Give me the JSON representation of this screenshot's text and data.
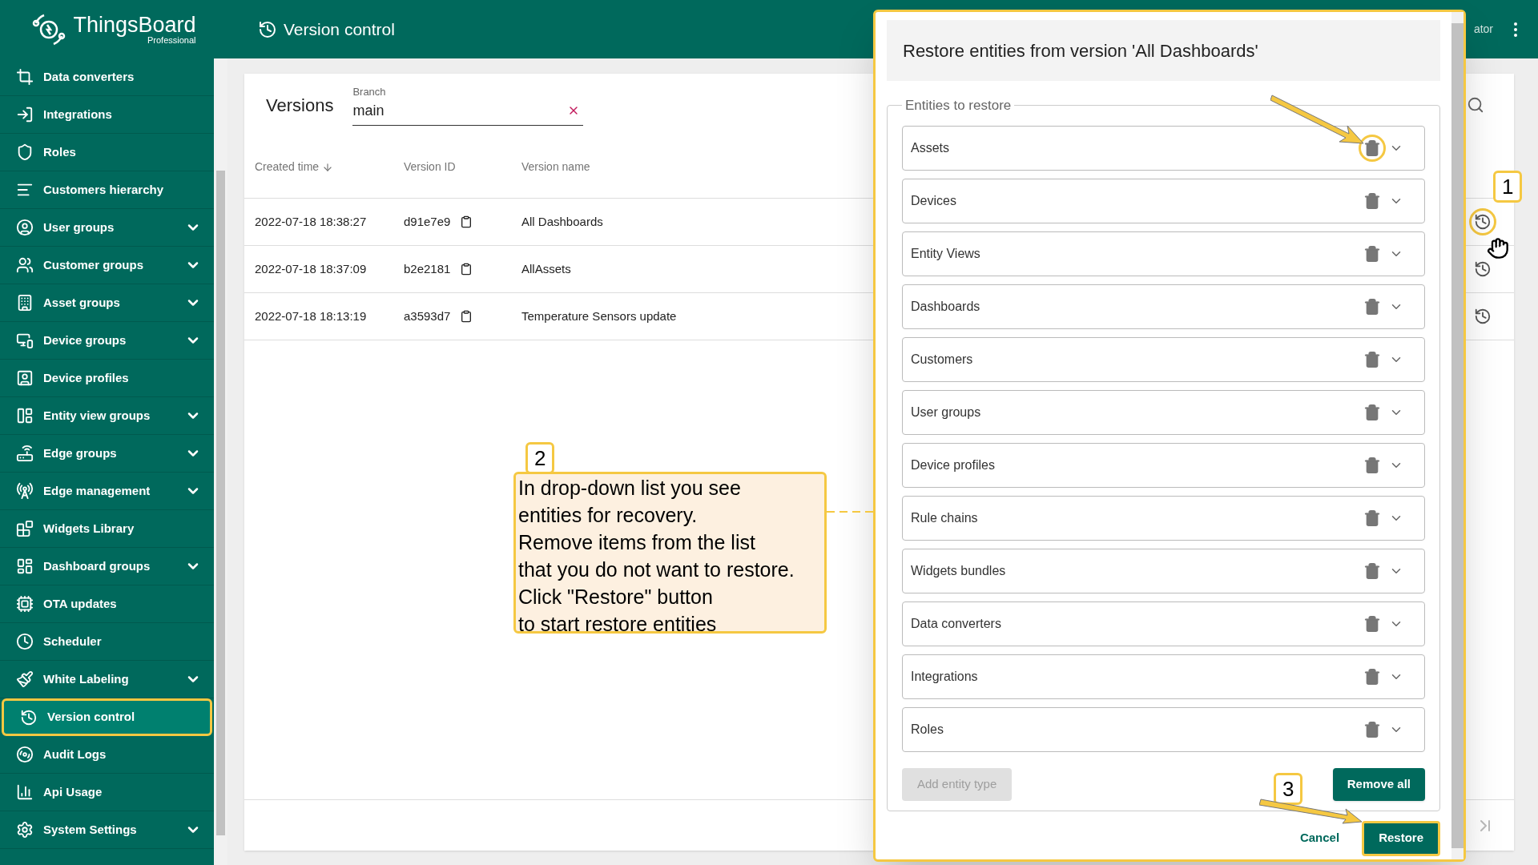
{
  "brand": {
    "name": "ThingsBoard",
    "edition": "Professional"
  },
  "header": {
    "title": "Version control",
    "user_text": "ator"
  },
  "sidebar": {
    "items": [
      {
        "label": "Data converters",
        "expandable": false,
        "selected": false
      },
      {
        "label": "Integrations",
        "expandable": false,
        "selected": false
      },
      {
        "label": "Roles",
        "expandable": false,
        "selected": false
      },
      {
        "label": "Customers hierarchy",
        "expandable": false,
        "selected": false
      },
      {
        "label": "User groups",
        "expandable": true,
        "selected": false
      },
      {
        "label": "Customer groups",
        "expandable": true,
        "selected": false
      },
      {
        "label": "Asset groups",
        "expandable": true,
        "selected": false
      },
      {
        "label": "Device groups",
        "expandable": true,
        "selected": false
      },
      {
        "label": "Device profiles",
        "expandable": false,
        "selected": false
      },
      {
        "label": "Entity view groups",
        "expandable": true,
        "selected": false
      },
      {
        "label": "Edge groups",
        "expandable": true,
        "selected": false
      },
      {
        "label": "Edge management",
        "expandable": true,
        "selected": false
      },
      {
        "label": "Widgets Library",
        "expandable": false,
        "selected": false
      },
      {
        "label": "Dashboard groups",
        "expandable": true,
        "selected": false
      },
      {
        "label": "OTA updates",
        "expandable": false,
        "selected": false
      },
      {
        "label": "Scheduler",
        "expandable": false,
        "selected": false
      },
      {
        "label": "White Labeling",
        "expandable": true,
        "selected": false
      },
      {
        "label": "Version control",
        "expandable": false,
        "selected": true
      },
      {
        "label": "Audit Logs",
        "expandable": false,
        "selected": false
      },
      {
        "label": "Api Usage",
        "expandable": false,
        "selected": false
      },
      {
        "label": "System Settings",
        "expandable": true,
        "selected": false
      }
    ]
  },
  "versions": {
    "title": "Versions",
    "branch": {
      "label": "Branch",
      "value": "main"
    },
    "columns": [
      "Created time",
      "Version ID",
      "Version name"
    ],
    "rows": [
      {
        "created_time": "2022-07-18 18:38:27",
        "version_id": "d91e7e9",
        "version_name": "All Dashboards",
        "highlighted": true
      },
      {
        "created_time": "2022-07-18 18:37:09",
        "version_id": "b2e2181",
        "version_name": "AllAssets",
        "highlighted": false
      },
      {
        "created_time": "2022-07-18 18:13:19",
        "version_id": "a3593d7",
        "version_name": "Temperature Sensors update",
        "highlighted": false
      }
    ]
  },
  "dialog": {
    "title": "Restore entities from version 'All Dashboards'",
    "section_label": "Entities to restore",
    "entities": [
      {
        "label": "Assets",
        "highlighted": true
      },
      {
        "label": "Devices",
        "highlighted": false
      },
      {
        "label": "Entity Views",
        "highlighted": false
      },
      {
        "label": "Dashboards",
        "highlighted": false
      },
      {
        "label": "Customers",
        "highlighted": false
      },
      {
        "label": "User groups",
        "highlighted": false
      },
      {
        "label": "Device profiles",
        "highlighted": false
      },
      {
        "label": "Rule chains",
        "highlighted": false
      },
      {
        "label": "Widgets bundles",
        "highlighted": false
      },
      {
        "label": "Data converters",
        "highlighted": false
      },
      {
        "label": "Integrations",
        "highlighted": false
      },
      {
        "label": "Roles",
        "highlighted": false
      }
    ],
    "add_button": {
      "label": "Add entity type",
      "disabled": true
    },
    "remove_all_button": "Remove all",
    "cancel_button": "Cancel",
    "restore_button": "Restore"
  },
  "annotations": [
    {
      "number": "1"
    },
    {
      "number": "2",
      "text": "In drop-down list you see\nentities for recovery.\nRemove items from the list\nthat you do not want to restore.\nClick \"Restore\" button\nto start restore entities"
    },
    {
      "number": "3"
    }
  ]
}
